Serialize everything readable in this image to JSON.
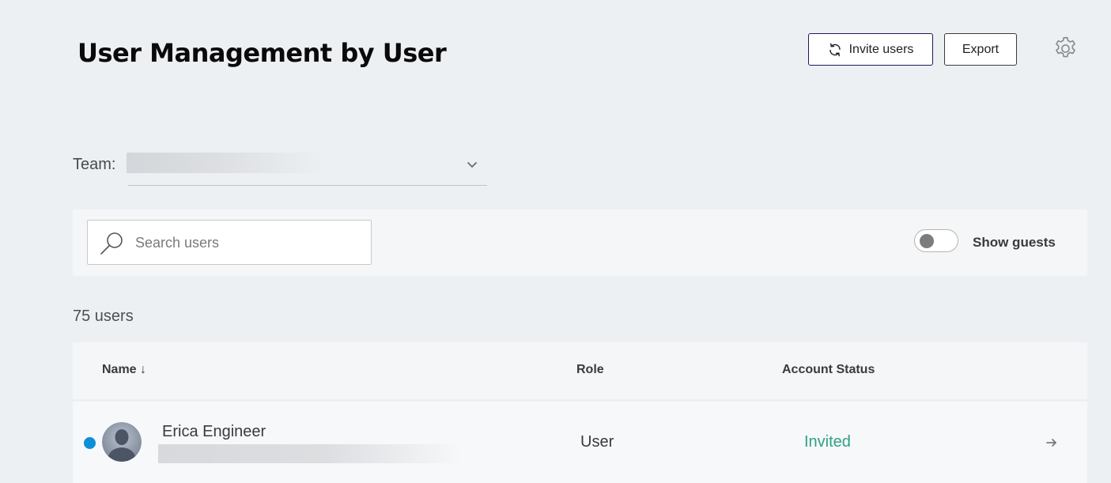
{
  "header": {
    "title": "User Management by User",
    "invite_label": "Invite users",
    "export_label": "Export"
  },
  "team": {
    "label": "Team:"
  },
  "filters": {
    "search_placeholder": "Search users",
    "search_value": "",
    "show_guests_label": "Show guests",
    "show_guests_on": false
  },
  "summary": {
    "user_count": "75 users"
  },
  "table": {
    "columns": [
      "Name ↓",
      "Role",
      "Account Status"
    ],
    "rows": [
      {
        "name": "Erica Engineer",
        "role": "User",
        "status": "Invited"
      }
    ]
  },
  "colors": {
    "accent_border": "#1d1a5c",
    "status_invited": "#2f9f86",
    "online_dot": "#0b8fd8"
  },
  "icons": {
    "invite": "sync-icon",
    "settings": "gear-icon",
    "search": "search-icon",
    "team_dropdown": "chevron-down-icon",
    "row_open": "arrow-right-icon"
  }
}
